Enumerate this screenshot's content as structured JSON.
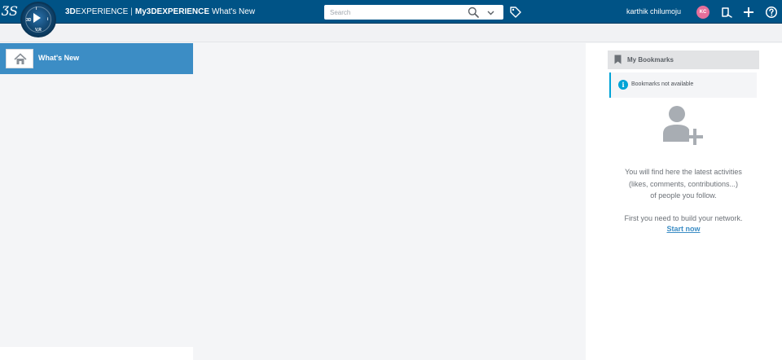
{
  "topbar": {
    "brand_3d": "3D",
    "brand_experience": "EXPERIENCE",
    "brand_separator": "|",
    "brand_my": "My3DEXPERIENCE",
    "app_title": "What's New",
    "search_placeholder": "Search",
    "user_name": "karthik chilumoju",
    "user_initials": "KC",
    "avatar_color": "#e56f9b",
    "compass_labels": {
      "top": "i",
      "left": "3D",
      "bottom": "V,R",
      "right": "i"
    }
  },
  "left_nav": {
    "items": [
      {
        "label": "What's New",
        "icon": "home-icon"
      }
    ],
    "selected_color": "#3c8dc5"
  },
  "bookmarks": {
    "title": "My Bookmarks",
    "info_text": "Bookmarks not available",
    "info_color": "#00a3d6"
  },
  "activity": {
    "message_lines": [
      "You will find here the latest activities",
      "(likes, comments, contributions...)",
      "of people you follow."
    ],
    "network_text": "First you need to build your network.",
    "start_link": "Start now"
  },
  "colors": {
    "topbar": "#005386",
    "link": "#3c8dc5"
  }
}
